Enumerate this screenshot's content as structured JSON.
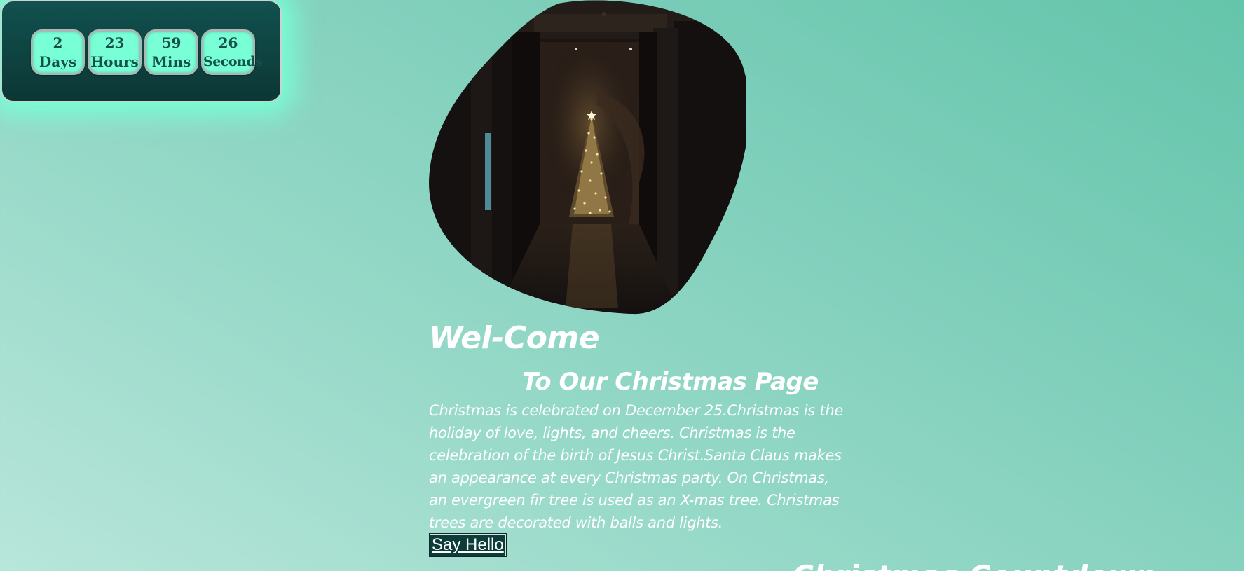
{
  "countdown": {
    "items": [
      {
        "value": "2",
        "unit": "Days"
      },
      {
        "value": "23",
        "unit": "Hours"
      },
      {
        "value": "59",
        "unit": "Mins"
      },
      {
        "value": "26",
        "unit": "Seconds"
      }
    ]
  },
  "hero": {
    "image_alt": "Christmas tree in a dark hallway",
    "title": "Wel-Come",
    "subtitle": "To Our Christmas Page",
    "body": "Christmas is celebrated on December 25.Christmas is the holiday of love, lights, and cheers. Christmas is the celebration of the birth of Jesus Christ.Santa Claus makes an appearance at every Christmas party. On Christmas, an evergreen fir tree is used as an X-mas tree. Christmas trees are decorated with balls and lights.",
    "button_label": "Say Hello"
  },
  "next_section": {
    "heading_partial": "Christmas Countdown"
  },
  "colors": {
    "accent_glow": "#78ffd6",
    "panel_dark": "#0c3735",
    "button_bg": "#0d3d3b",
    "text_light": "#ffffff"
  }
}
